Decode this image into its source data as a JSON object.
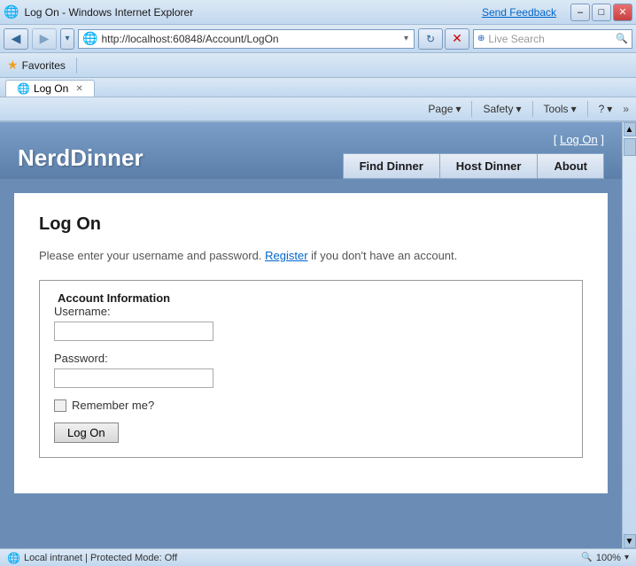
{
  "titlebar": {
    "icon": "🌐",
    "text": "Log On - Windows Internet Explorer",
    "feedback_label": "Send Feedback",
    "min_label": "–",
    "max_label": "□",
    "close_label": "✕"
  },
  "addressbar": {
    "address": "http://localhost:60848/Account/LogOn",
    "refresh_icon": "↻",
    "stop_icon": "✕",
    "back_icon": "◀",
    "forward_icon": "▶",
    "live_search_label": "Live Search",
    "search_icon": "🔍"
  },
  "favbar": {
    "star_icon": "★",
    "favorites_label": "Favorites",
    "tab_icon": "🌐",
    "tab_label": "Log On"
  },
  "toolbar": {
    "page_label": "Page",
    "safety_label": "Safety",
    "tools_label": "Tools",
    "help_icon": "?",
    "chevron": "▾"
  },
  "header": {
    "logo": "NerdDinner",
    "login_prefix": "[",
    "login_label": "Log On",
    "login_suffix": "]",
    "nav": {
      "find_dinner": "Find Dinner",
      "host_dinner": "Host Dinner",
      "about": "About"
    }
  },
  "page": {
    "title": "Log On",
    "intro": "Please enter your username and password.",
    "register_label": "Register",
    "intro_suffix": " if you don't have an account.",
    "fieldset_legend": "Account Information",
    "username_label": "Username:",
    "password_label": "Password:",
    "remember_label": "Remember me?",
    "logon_btn": "Log On"
  },
  "statusbar": {
    "status_icon": "🌐",
    "status_text": "Local intranet | Protected Mode: Off",
    "zoom_icon": "🔍",
    "zoom_text": "100%",
    "chevron": "▾"
  }
}
